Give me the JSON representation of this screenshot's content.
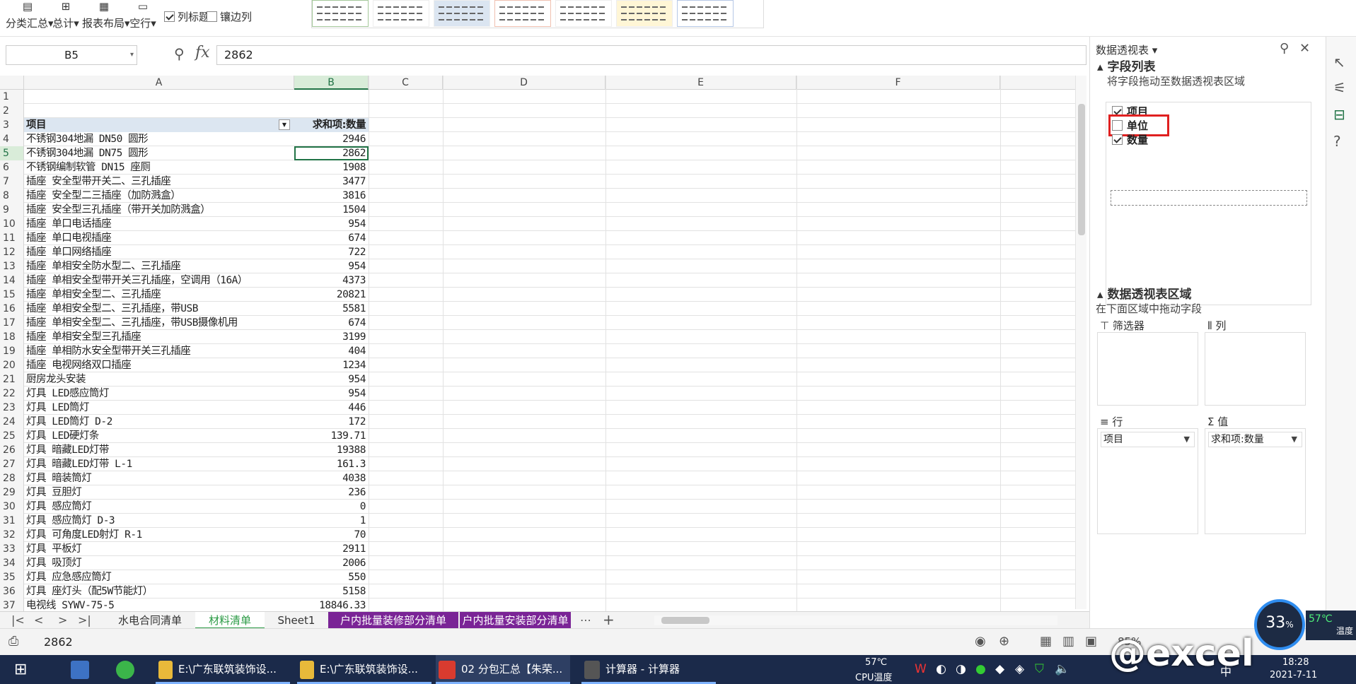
{
  "ribbon": {
    "subtotal": "分类汇总",
    "grand_total": "总计",
    "report_layout": "报表布局",
    "blank_rows": "空行",
    "col_headers": "列标题",
    "banded_cols": "镶边列"
  },
  "formula_bar": {
    "name_box": "B5",
    "fx": "fx",
    "formula": "2862"
  },
  "columns": [
    "A",
    "B",
    "C",
    "D",
    "E",
    "F"
  ],
  "pivot_header": {
    "item": "项目",
    "sum": "求和项:数量"
  },
  "rows": [
    {
      "n": "1",
      "a": "",
      "b": ""
    },
    {
      "n": "2",
      "a": "",
      "b": ""
    },
    {
      "n": "3",
      "a": "",
      "b": ""
    },
    {
      "n": "4",
      "a": "不锈钢304地漏 DN50 圆形",
      "b": "2946"
    },
    {
      "n": "5",
      "a": "不锈钢304地漏 DN75 圆形",
      "b": "2862"
    },
    {
      "n": "6",
      "a": "不锈钢编制软管 DN15 座厕",
      "b": "1908"
    },
    {
      "n": "7",
      "a": "插座 安全型带开关二、三孔插座",
      "b": "3477"
    },
    {
      "n": "8",
      "a": "插座 安全型二三插座（加防溅盒）",
      "b": "3816"
    },
    {
      "n": "9",
      "a": "插座 安全型三孔插座（带开关加防溅盒）",
      "b": "1504"
    },
    {
      "n": "10",
      "a": "插座 单口电话插座",
      "b": "954"
    },
    {
      "n": "11",
      "a": "插座 单口电视插座",
      "b": "674"
    },
    {
      "n": "12",
      "a": "插座 单口网络插座",
      "b": "722"
    },
    {
      "n": "13",
      "a": "插座 单相安全防水型二、三孔插座",
      "b": "954"
    },
    {
      "n": "14",
      "a": "插座 单相安全型带开关三孔插座，空调用（16A）",
      "b": "4373"
    },
    {
      "n": "15",
      "a": "插座 单相安全型二、三孔插座",
      "b": "20821"
    },
    {
      "n": "16",
      "a": "插座 单相安全型二、三孔插座，带USB",
      "b": "5581"
    },
    {
      "n": "17",
      "a": "插座 单相安全型二、三孔插座，带USB摄像机用",
      "b": "674"
    },
    {
      "n": "18",
      "a": "插座 单相安全型三孔插座",
      "b": "3199"
    },
    {
      "n": "19",
      "a": "插座 单相防水安全型带开关三孔插座",
      "b": "404"
    },
    {
      "n": "20",
      "a": "插座 电视网络双口插座",
      "b": "1234"
    },
    {
      "n": "21",
      "a": "厨房龙头安装",
      "b": "954"
    },
    {
      "n": "22",
      "a": "灯具 LED感应筒灯",
      "b": "954"
    },
    {
      "n": "23",
      "a": "灯具 LED筒灯",
      "b": "446"
    },
    {
      "n": "24",
      "a": "灯具 LED筒灯 D-2",
      "b": "172"
    },
    {
      "n": "25",
      "a": "灯具 LED硬灯条",
      "b": "139.71"
    },
    {
      "n": "26",
      "a": "灯具 暗藏LED灯带",
      "b": "19388"
    },
    {
      "n": "27",
      "a": "灯具 暗藏LED灯带 L-1",
      "b": "161.3"
    },
    {
      "n": "28",
      "a": "灯具 暗装筒灯",
      "b": "4038"
    },
    {
      "n": "29",
      "a": "灯具 豆胆灯",
      "b": "236"
    },
    {
      "n": "30",
      "a": "灯具 感应筒灯",
      "b": "0"
    },
    {
      "n": "31",
      "a": "灯具 感应筒灯 D-3",
      "b": "1"
    },
    {
      "n": "32",
      "a": "灯具 可角度LED射灯 R-1",
      "b": "70"
    },
    {
      "n": "33",
      "a": "灯具 平板灯",
      "b": "2911"
    },
    {
      "n": "34",
      "a": "灯具 吸顶灯",
      "b": "2006"
    },
    {
      "n": "35",
      "a": "灯具 应急感应筒灯",
      "b": "550"
    },
    {
      "n": "36",
      "a": "灯具 座灯头（配5W节能灯）",
      "b": "5158"
    },
    {
      "n": "37",
      "a": "电视线 SYWV-75-5",
      "b": "18846.33"
    }
  ],
  "sheet_tabs": [
    "水电合同清单",
    "材料清单",
    "Sheet1",
    "户内批量装修部分清单",
    "户内批量安装部分清单"
  ],
  "status_value": "2862",
  "status_zoom": "85%",
  "pane": {
    "title": "数据透视表",
    "field_list_title": "字段列表",
    "field_list_desc": "将字段拖动至数据透视表区域",
    "fields": [
      {
        "label": "项目",
        "checked": true
      },
      {
        "label": "单位",
        "checked": false
      },
      {
        "label": "数量",
        "checked": true
      }
    ],
    "areas_title": "数据透视表区域",
    "areas_desc": "在下面区域中拖动字段",
    "filter_label": "筛选器",
    "col_label": "列",
    "row_label": "行",
    "value_label": "值",
    "row_field": "项目",
    "value_field": "求和项:数量"
  },
  "taskbar": {
    "items": [
      "E:\\广东联筑装饰设...",
      "E:\\广东联筑装饰设...",
      "02 分包汇总【朱荣...",
      "计算器 - 计算器"
    ],
    "cpu_temp": "57℃",
    "cpu_label": "CPU温度",
    "ime": "中",
    "time": "18:28",
    "date": "2021-7-11"
  },
  "overlay": {
    "cpu_percent": "33",
    "temp": "57℃",
    "temp_label": "温度",
    "watermark": "@excel"
  },
  "colors": {
    "accent_green": "#217346",
    "tab_purple": "#7a2496",
    "highlight_red": "#e02020"
  }
}
